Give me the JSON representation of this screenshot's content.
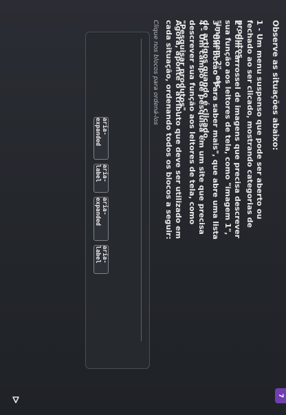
{
  "question": {
    "prompt": "Observe as situações abaixo:",
    "items": [
      {
        "text": "1 - Um menu suspenso que pode ser aberto ou fechado ao ser clicado, mostrando categorias de produtos."
      },
      {
        "text": "2 - Um carrossel de imagens que precisa descrever sua função aos leitores de tela, como \"imagem 1\", \"imagem 2\", etc."
      },
      {
        "text": "3 - Um botão \"Para saber mais\", que abre uma lista de artigos quando é clicado."
      },
      {
        "text": "4 - Um campo de pesquisa em um site que precisa descrever sua função aos leitores de tela, como \"Pesquisar produtos\"."
      }
    ],
    "instruction": "Agora, aponte o atributo que deve ser utilizado em cada situação, ordenando todos os blocos a seguir:",
    "hint": "Clique nos blocos para ordená-los"
  },
  "answer_chips": [
    {
      "label": "aria-expanded"
    },
    {
      "label": "aria-label"
    },
    {
      "label": "aria-expanded"
    },
    {
      "label": "aria-label"
    }
  ],
  "badge": {
    "label": "7"
  },
  "icons": {
    "caret": "caret-icon"
  },
  "colors": {
    "background": "#24272d",
    "badge": "#6f3fb2",
    "chip_border": "#7d828b"
  }
}
